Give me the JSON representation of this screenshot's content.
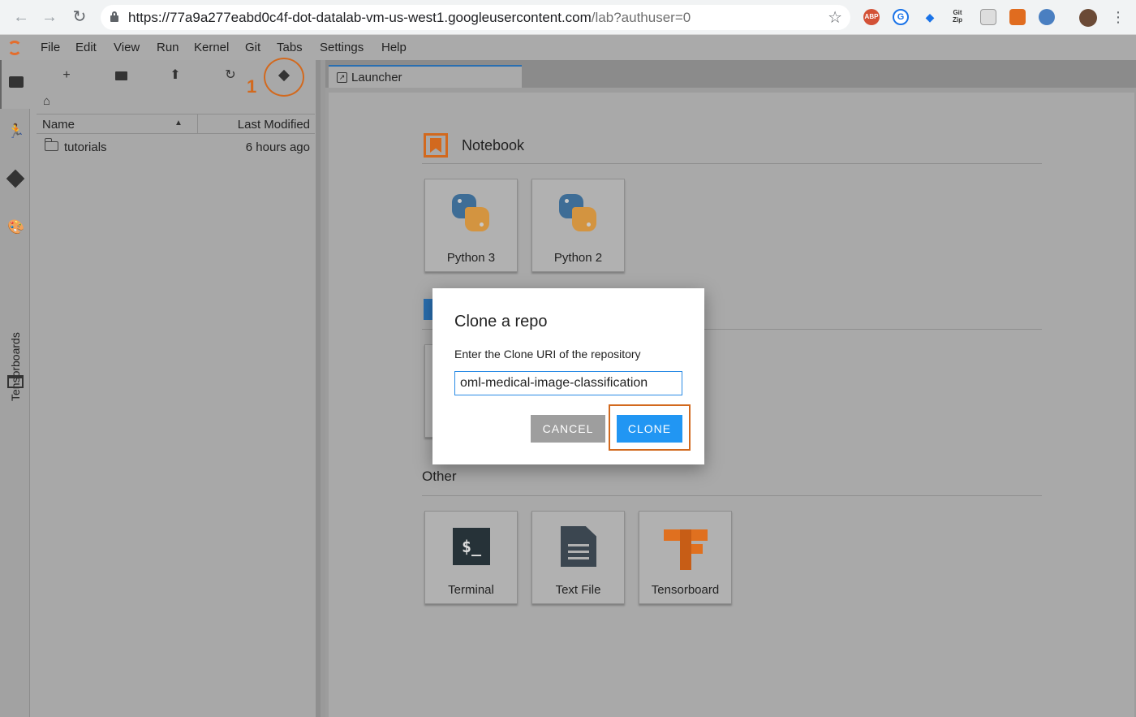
{
  "browser": {
    "url_host": "https://77a9a277eabd0c4f-dot-datalab-vm-us-west1.googleusercontent.com",
    "url_path": "/lab?authuser=0",
    "extensions": [
      "ABP",
      "G",
      "Git Zip"
    ]
  },
  "menu": {
    "items": [
      "File",
      "Edit",
      "View",
      "Run",
      "Kernel",
      "Git",
      "Tabs",
      "Settings",
      "Help"
    ]
  },
  "sidebar": {
    "tensorboards_label": "Tensorboards"
  },
  "file_browser": {
    "step_annotation": "1",
    "columns": {
      "name": "Name",
      "modified": "Last Modified"
    },
    "rows": [
      {
        "name": "tutorials",
        "modified": "6 hours ago"
      }
    ]
  },
  "tabs": [
    {
      "label": "Launcher"
    }
  ],
  "launcher": {
    "notebook_section": "Notebook",
    "notebook_cards": [
      "Python 3",
      "Python 2"
    ],
    "other_section": "Other",
    "other_cards": [
      "Terminal",
      "Text File",
      "Tensorboard"
    ],
    "terminal_glyph": "$_"
  },
  "dialog": {
    "title": "Clone a repo",
    "label": "Enter the Clone URI of the repository",
    "input_value": "oml-medical-image-classification",
    "cancel_label": "CANCEL",
    "clone_label": "CLONE"
  },
  "colors": {
    "accent": "#d2691e",
    "primary_button": "#2196f3",
    "secondary_button": "#9e9e9e"
  }
}
